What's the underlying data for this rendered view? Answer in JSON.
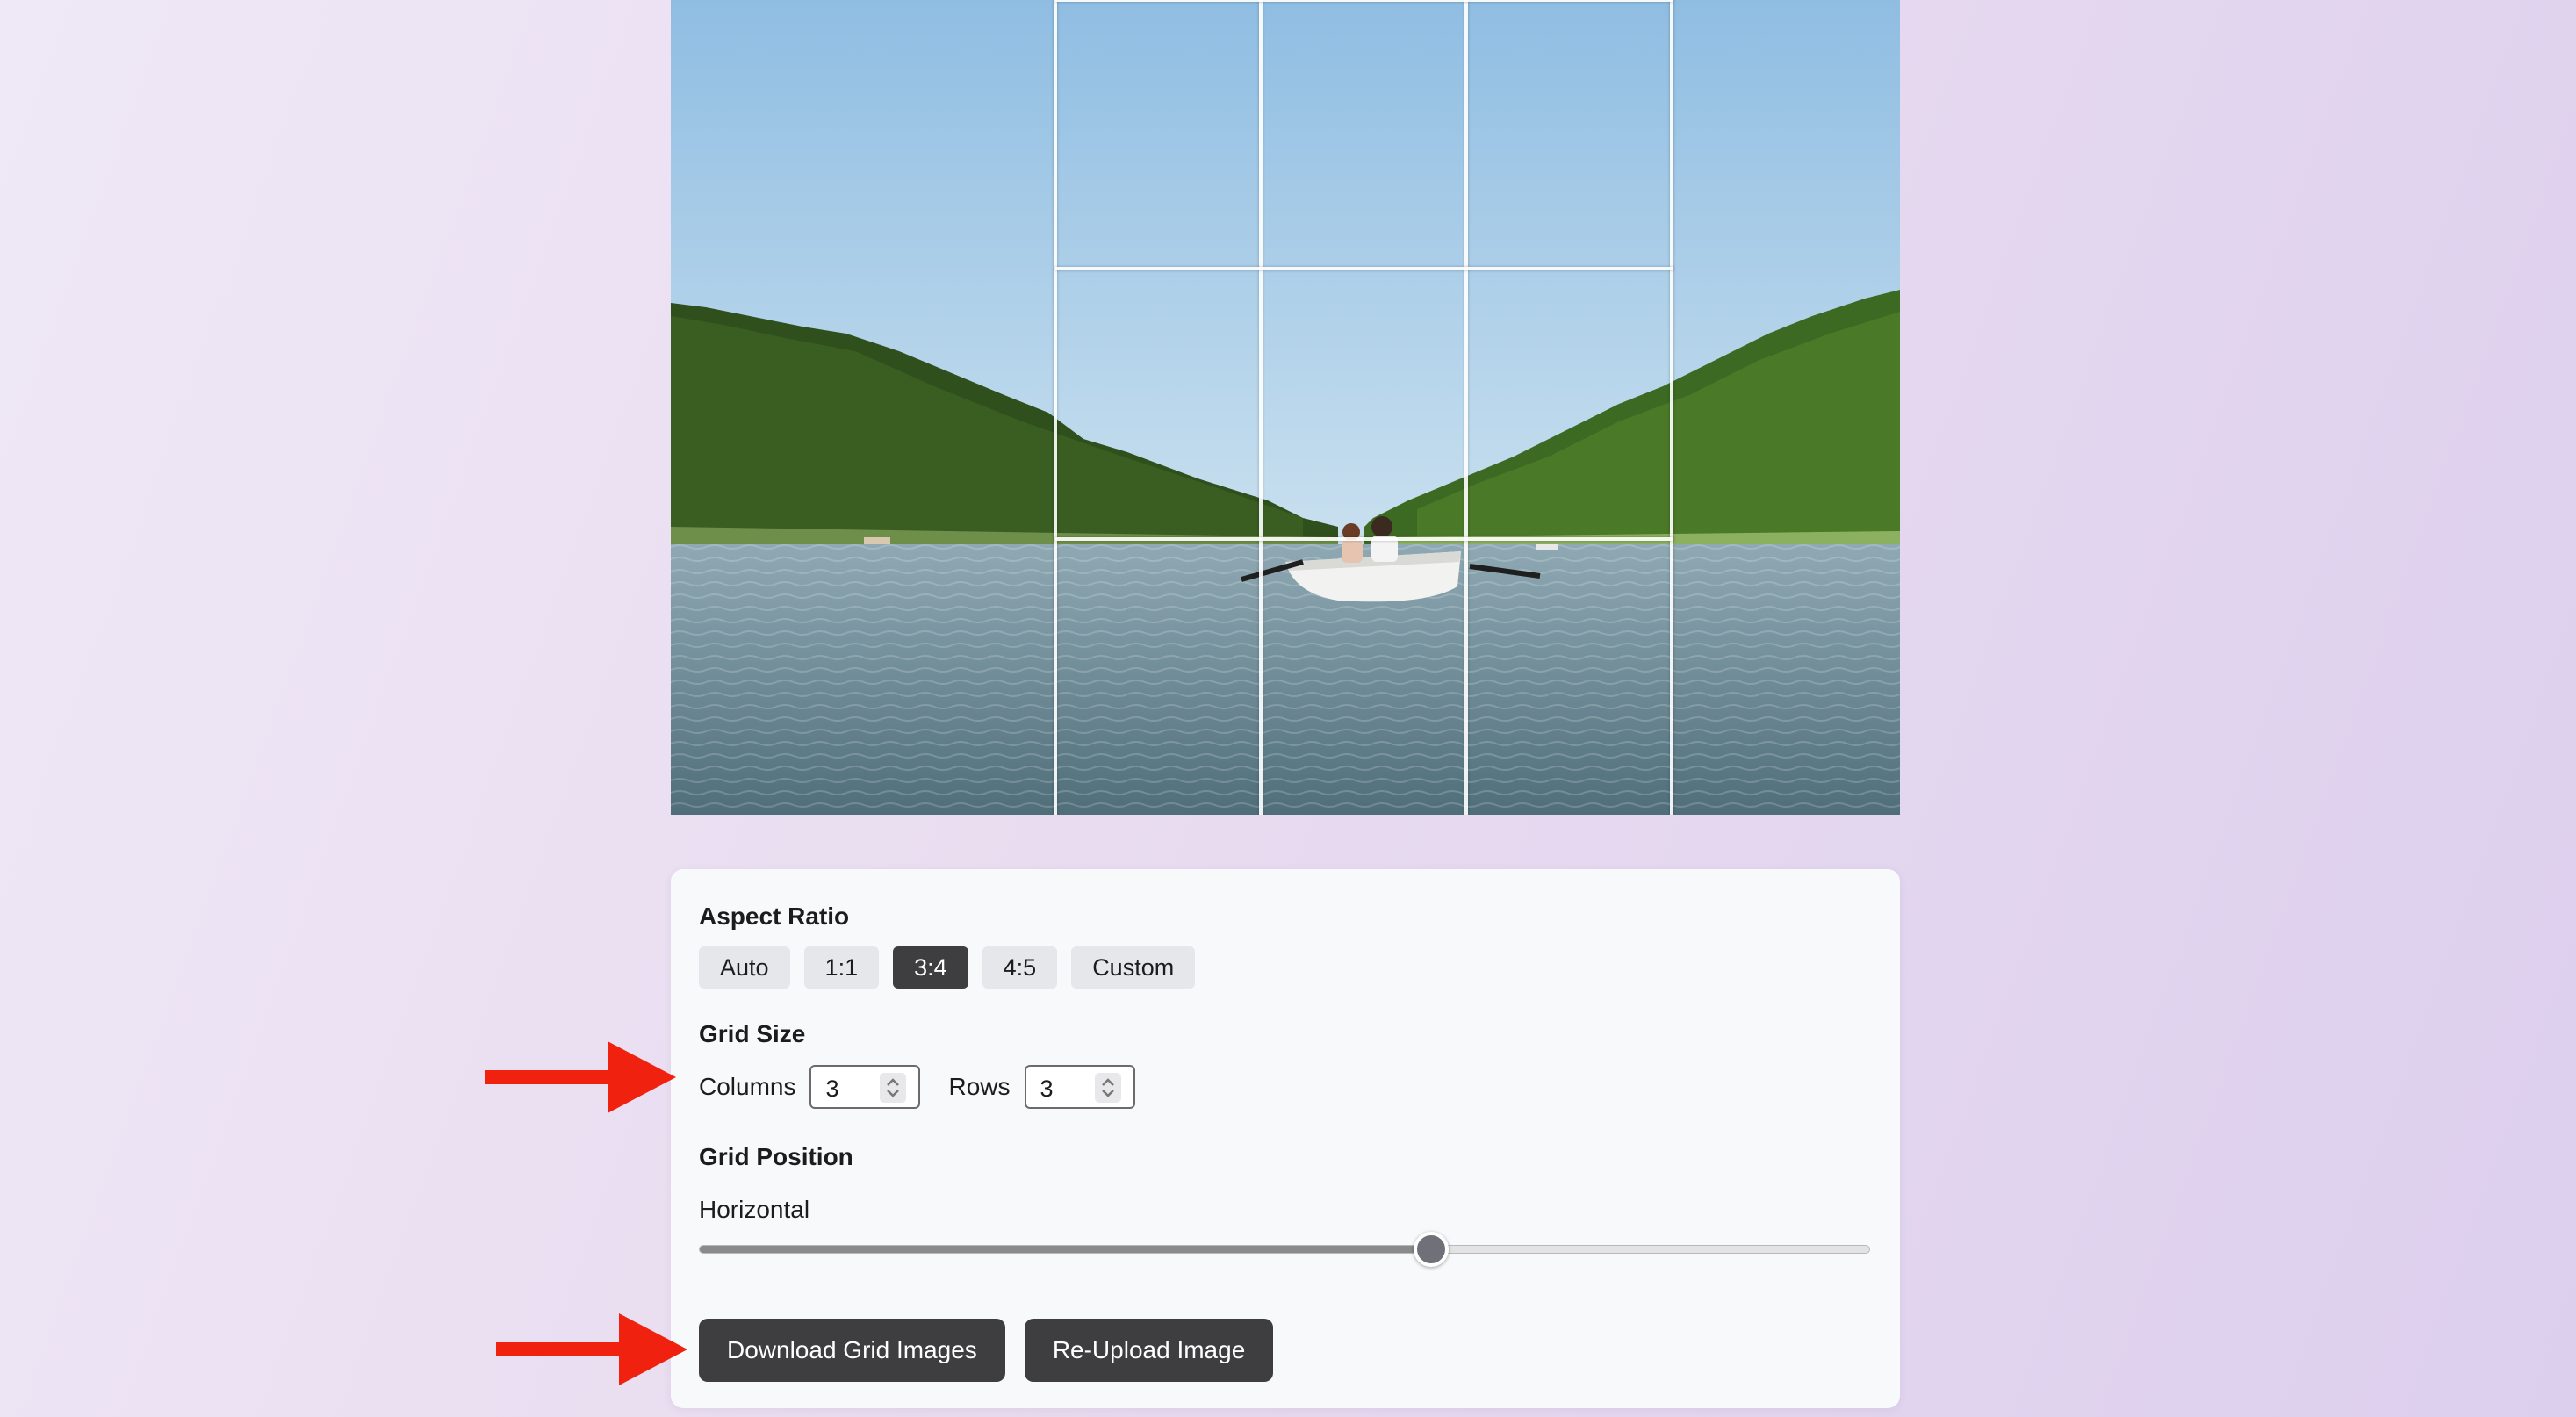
{
  "preview": {
    "grid_columns": 3,
    "grid_rows": 3
  },
  "aspect_ratio": {
    "label": "Aspect Ratio",
    "options": [
      "Auto",
      "1:1",
      "3:4",
      "4:5",
      "Custom"
    ],
    "selected": "3:4"
  },
  "grid_size": {
    "label": "Grid Size",
    "columns_label": "Columns",
    "columns_value": "3",
    "rows_label": "Rows",
    "rows_value": "3"
  },
  "grid_position": {
    "label": "Grid Position",
    "horizontal_label": "Horizontal",
    "horizontal_value": 0.625
  },
  "actions": {
    "download_label": "Download Grid Images",
    "reupload_label": "Re-Upload Image"
  },
  "annotations": {
    "arrow_color": "#f0220f"
  }
}
